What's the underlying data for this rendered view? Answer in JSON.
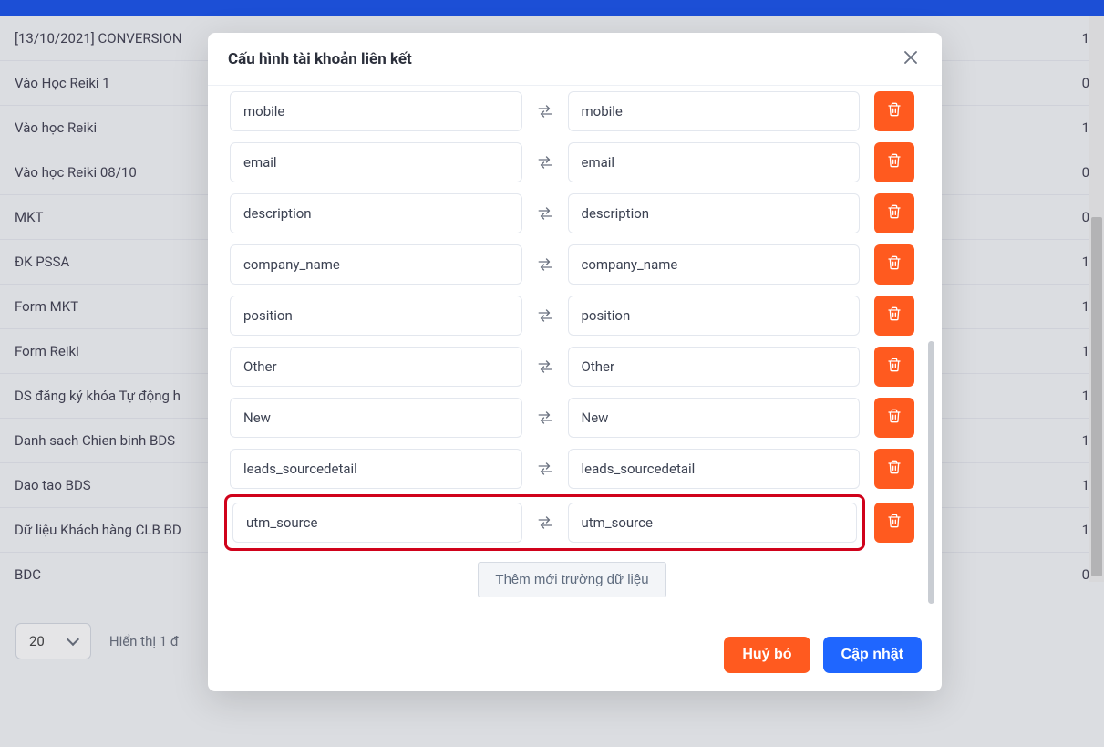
{
  "modal": {
    "title": "Cấu hình tài khoản liên kết",
    "add_button": "Thêm mới trường dữ liệu",
    "cancel_button": "Huỷ bỏ",
    "update_button": "Cập nhật",
    "mappings": [
      {
        "left": "mobile",
        "right": "mobile",
        "highlighted": false
      },
      {
        "left": "email",
        "right": "email",
        "highlighted": false
      },
      {
        "left": "description",
        "right": "description",
        "highlighted": false
      },
      {
        "left": "company_name",
        "right": "company_name",
        "highlighted": false
      },
      {
        "left": "position",
        "right": "position",
        "highlighted": false
      },
      {
        "left": "Other",
        "right": "Other",
        "highlighted": false
      },
      {
        "left": "New",
        "right": "New",
        "highlighted": false
      },
      {
        "left": "leads_sourcedetail",
        "right": "leads_sourcedetail",
        "highlighted": false
      },
      {
        "left": "utm_source",
        "right": "utm_source",
        "highlighted": true
      }
    ]
  },
  "background_table": {
    "rows": [
      {
        "name": "[13/10/2021] CONVERSION",
        "count": "1"
      },
      {
        "name": "Vào Học Reiki 1",
        "count": "0"
      },
      {
        "name": "Vào học Reiki",
        "count": "1"
      },
      {
        "name": "Vào học Reiki 08/10",
        "count": "0"
      },
      {
        "name": "MKT",
        "count": "0"
      },
      {
        "name": "ĐK PSSA",
        "count": "1"
      },
      {
        "name": "Form MKT",
        "count": "1"
      },
      {
        "name": "Form Reiki",
        "count": "1"
      },
      {
        "name": "DS đăng ký khóa Tự động h",
        "count": "1"
      },
      {
        "name": "Danh sach Chien binh BDS",
        "count": "1"
      },
      {
        "name": "Dao tao BDS",
        "count": "1"
      },
      {
        "name": "Dữ liệu Khách hàng CLB BD",
        "count": "1"
      },
      {
        "name": "BDC",
        "count": "0"
      }
    ]
  },
  "pager": {
    "page_size": "20",
    "display_text": "Hiển thị 1 đ"
  }
}
